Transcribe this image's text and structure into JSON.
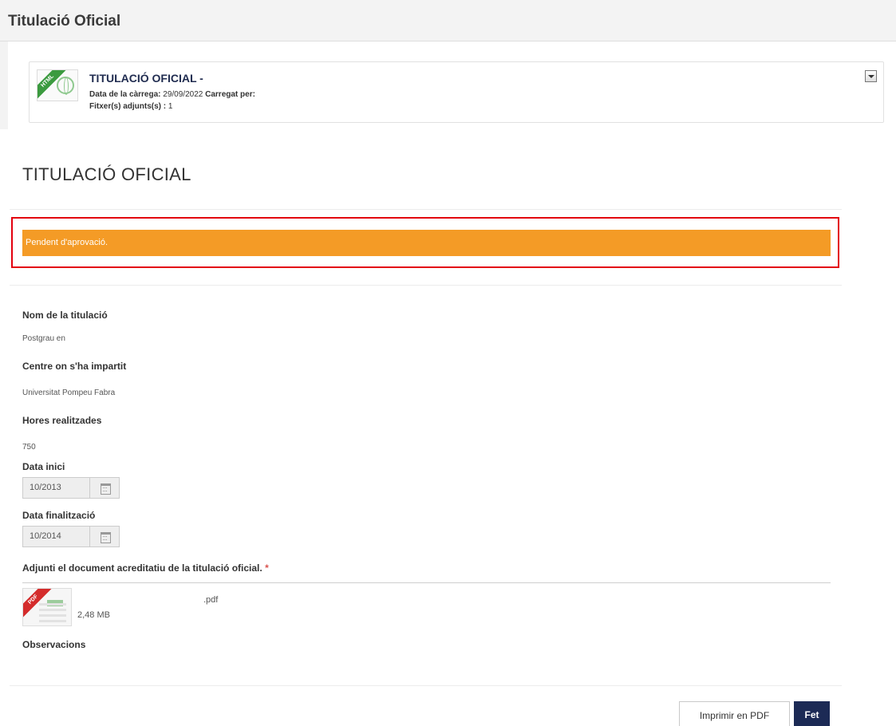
{
  "header": {
    "title": "Titulació Oficial"
  },
  "file_card": {
    "title": "TITULACIÓ OFICIAL -",
    "icon_label": "HTML",
    "upload_date_label": "Data de la càrrega:",
    "upload_date": "29/09/2022",
    "uploaded_by_label": "Carregat per:",
    "attachments_label": "Fitxer(s) adjunts(s) :",
    "attachments_count": "1"
  },
  "form": {
    "title": "TITULACIÓ OFICIAL",
    "status": "Pendent d'aprovació.",
    "status_color": "#f49b26",
    "degree_name_label": "Nom de la titulació",
    "degree_name_value": "Postgrau en",
    "center_label": "Centre on s'ha impartit",
    "center_value": "Universitat Pompeu Fabra",
    "hours_label": "Hores realitzades",
    "hours_value": "750",
    "start_date_label": "Data inici",
    "start_date_value": "10/2013",
    "end_date_label": "Data finalització",
    "end_date_value": "10/2014",
    "attachment_label": "Adjunti el document acreditatiu de la titulació oficial.",
    "required_marker": "*",
    "attachment": {
      "icon_label": "PDF",
      "name": ".pdf",
      "size": "2,48 MB"
    },
    "observations_label": "Observacions"
  },
  "actions": {
    "print_label": "Imprimir en PDF",
    "done_label": "Fet",
    "done_color": "#1c2a55"
  }
}
